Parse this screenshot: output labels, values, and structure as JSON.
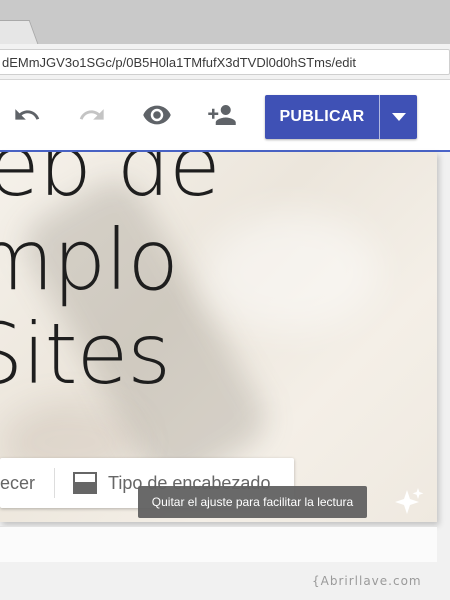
{
  "browser": {
    "url": "dEMmJGV3o1SGc/p/0B5H0la1TMfufX3dTVDl0d0hSTms/edit"
  },
  "toolbar": {
    "undo_icon": "undo-icon",
    "redo_icon": "redo-icon",
    "preview_icon": "eye-icon",
    "share_icon": "add-person-icon",
    "publish_label": "PUBLICAR",
    "publish_dropdown_icon": "caret-down-icon",
    "accent_color": "#3f51b5"
  },
  "hero": {
    "title_lines": [
      "eb de",
      "mplo",
      "Sites"
    ]
  },
  "hero_tools": {
    "left_partial_label": "ecer",
    "header_type_label": "Tipo de encabezado",
    "header_type_icon": "header-layout-icon"
  },
  "tooltip": {
    "text": "Quitar el ajuste para facilitar la lectura"
  },
  "watermark": {
    "text": "{Abrirllave.com"
  }
}
